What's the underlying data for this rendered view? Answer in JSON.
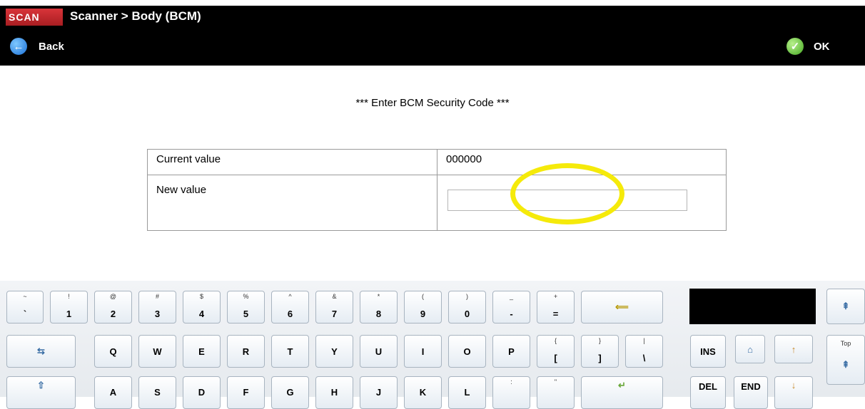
{
  "header": {
    "logo_text": "SCAN",
    "title": "Scanner  > Body (BCM)",
    "back_label": "Back",
    "ok_label": "OK"
  },
  "content": {
    "heading": "*** Enter BCM Security Code ***",
    "current_label": "Current value",
    "current_value": "000000",
    "new_label": "New value",
    "new_value": ""
  },
  "keyboard": {
    "row1": [
      {
        "upper": "~",
        "lower": "`"
      },
      {
        "upper": "!",
        "lower": "1"
      },
      {
        "upper": "@",
        "lower": "2"
      },
      {
        "upper": "#",
        "lower": "3"
      },
      {
        "upper": "$",
        "lower": "4"
      },
      {
        "upper": "%",
        "lower": "5"
      },
      {
        "upper": "^",
        "lower": "6"
      },
      {
        "upper": "&",
        "lower": "7"
      },
      {
        "upper": "*",
        "lower": "8"
      },
      {
        "upper": "(",
        "lower": "9"
      },
      {
        "upper": ")",
        "lower": "0"
      },
      {
        "upper": "_",
        "lower": "-"
      },
      {
        "upper": "+",
        "lower": "="
      }
    ],
    "backspace_glyph": "⟸",
    "tab_glyph": "⇆",
    "row2": [
      "Q",
      "W",
      "E",
      "R",
      "T",
      "Y",
      "U",
      "I",
      "O",
      "P"
    ],
    "row2_brackets": [
      {
        "upper": "{",
        "lower": "["
      },
      {
        "upper": "}",
        "lower": "]"
      },
      {
        "upper": "|",
        "lower": "\\"
      }
    ],
    "row3": [
      "A",
      "S",
      "D",
      "F",
      "G",
      "H",
      "J",
      "K",
      "L"
    ],
    "row3_punct": [
      {
        "upper": ":",
        "lower": ";"
      },
      {
        "upper": "\"",
        "lower": "'"
      }
    ],
    "caps_glyph": "⇧",
    "enter_glyph": "↵",
    "nav": {
      "ins": "INS",
      "del": "DEL",
      "end": "END",
      "home_glyph": "⌂",
      "up_glyph": "↑",
      "down_glyph": "↓",
      "top_label": "Top",
      "top_glyph": "⇞",
      "page_glyph": "⇞"
    }
  }
}
